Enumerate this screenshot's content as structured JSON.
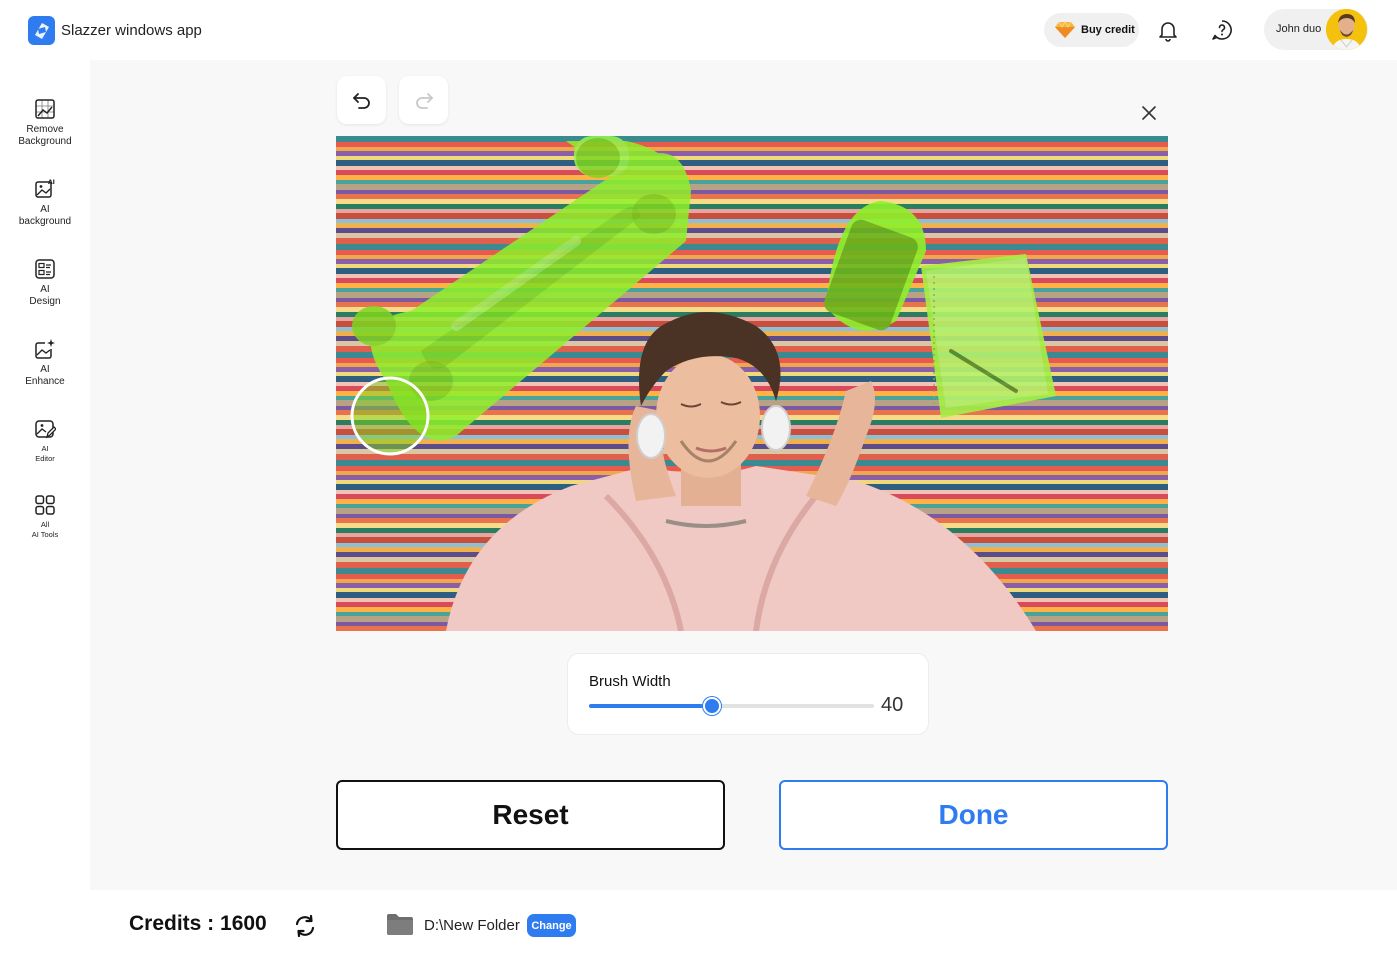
{
  "header": {
    "app_title": "Slazzer windows app",
    "buy_credit_label": "Buy credit",
    "user_name": "John duo"
  },
  "sidebar": {
    "items": [
      {
        "label_line1": "Remove",
        "label_line2": "Background",
        "icon": "image-grid-icon"
      },
      {
        "label_line1": "AI",
        "label_line2": "background",
        "icon": "ai-image-icon"
      },
      {
        "label_line1": "AI",
        "label_line2": "Design",
        "icon": "design-layout-icon"
      },
      {
        "label_line1": "AI",
        "label_line2": "Enhance",
        "icon": "enhance-sparkle-icon"
      },
      {
        "label_line1": "AI",
        "label_line2": "Editor",
        "icon": "editor-image-icon"
      },
      {
        "label_line1": "All",
        "label_line2": "AI Tools",
        "icon": "grid-tools-icon"
      }
    ]
  },
  "editor": {
    "brush_label": "Brush Width",
    "brush_value": "40",
    "brush_fraction": 0.43,
    "reset_label": "Reset",
    "done_label": "Done"
  },
  "footer": {
    "credits_text": "Credits : 1600",
    "folder_path": "D:\\New Folder",
    "change_label": "Change"
  },
  "colors": {
    "accent": "#2f7cf0",
    "mask": "#9bf032"
  }
}
